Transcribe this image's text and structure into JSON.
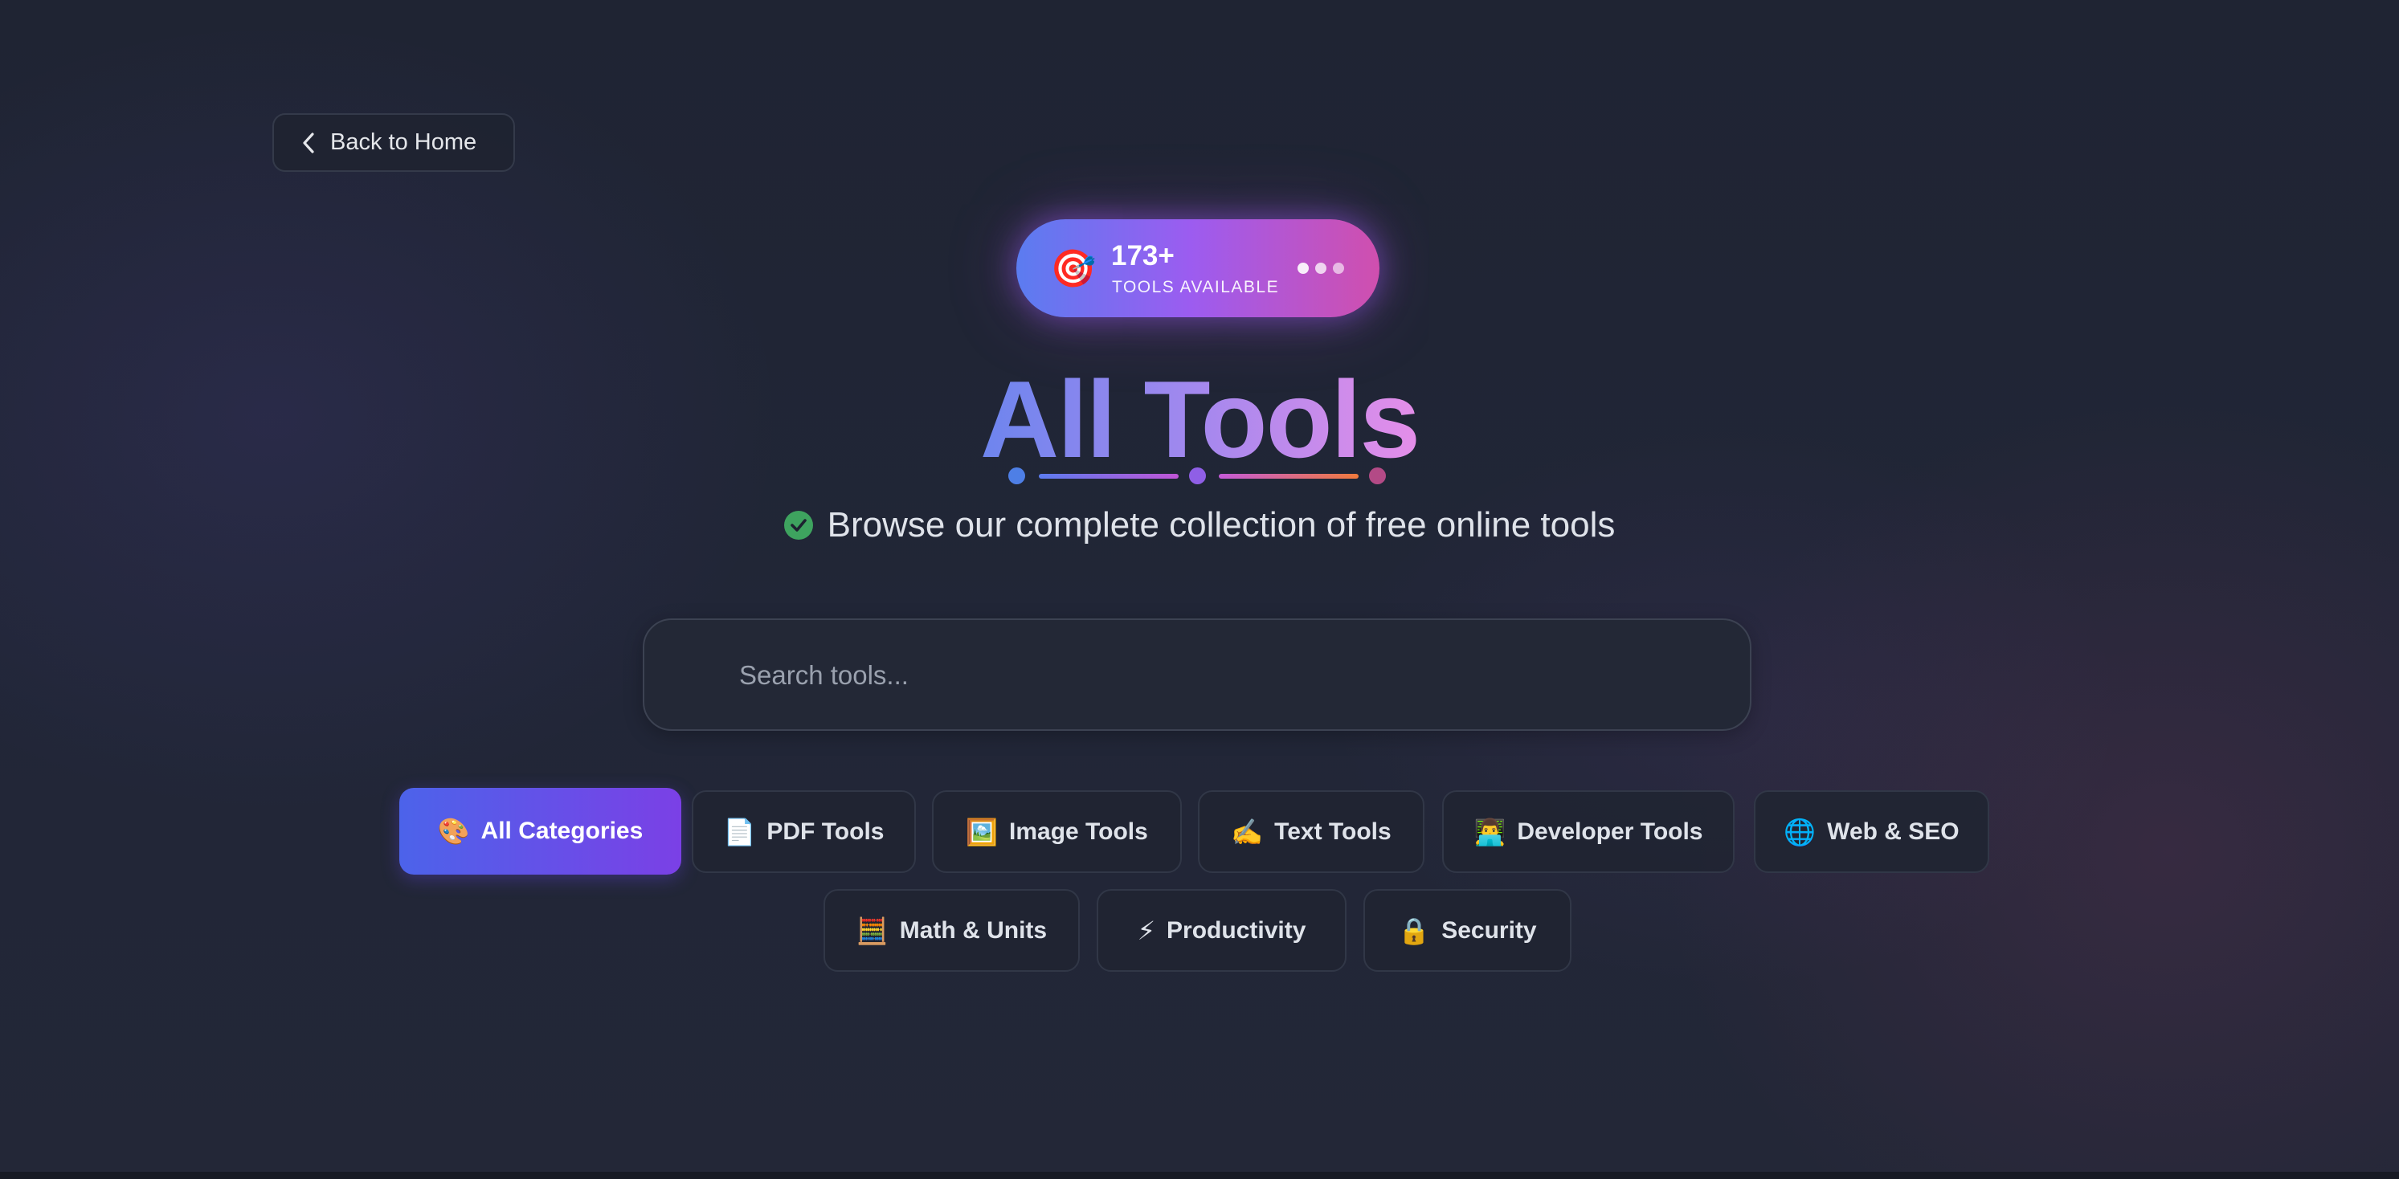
{
  "nav": {
    "back_label": "Back to Home"
  },
  "badge": {
    "icon": "🎯",
    "count": "173+",
    "label": "TOOLS AVAILABLE"
  },
  "hero": {
    "title": "All Tools",
    "subtitle": "Browse our complete collection of free online tools"
  },
  "search": {
    "placeholder": "Search tools..."
  },
  "categories": [
    {
      "icon": "🎨",
      "label": "All Categories",
      "active": true
    },
    {
      "icon": "📄",
      "label": "PDF Tools"
    },
    {
      "icon": "🖼️",
      "label": "Image Tools"
    },
    {
      "icon": "✍️",
      "label": "Text Tools"
    },
    {
      "icon": "👨‍💻",
      "label": "Developer Tools"
    },
    {
      "icon": "🌐",
      "label": "Web & SEO"
    },
    {
      "icon": "🧮",
      "label": "Math & Units"
    },
    {
      "icon": "⚡",
      "label": "Productivity"
    },
    {
      "icon": "🔒",
      "label": "Security"
    }
  ],
  "colors": {
    "background": "#212637",
    "accent_blue": "#4c63ea",
    "accent_purple": "#7b40e6",
    "accent_pink": "#d04fae",
    "success": "#3ea35f"
  }
}
